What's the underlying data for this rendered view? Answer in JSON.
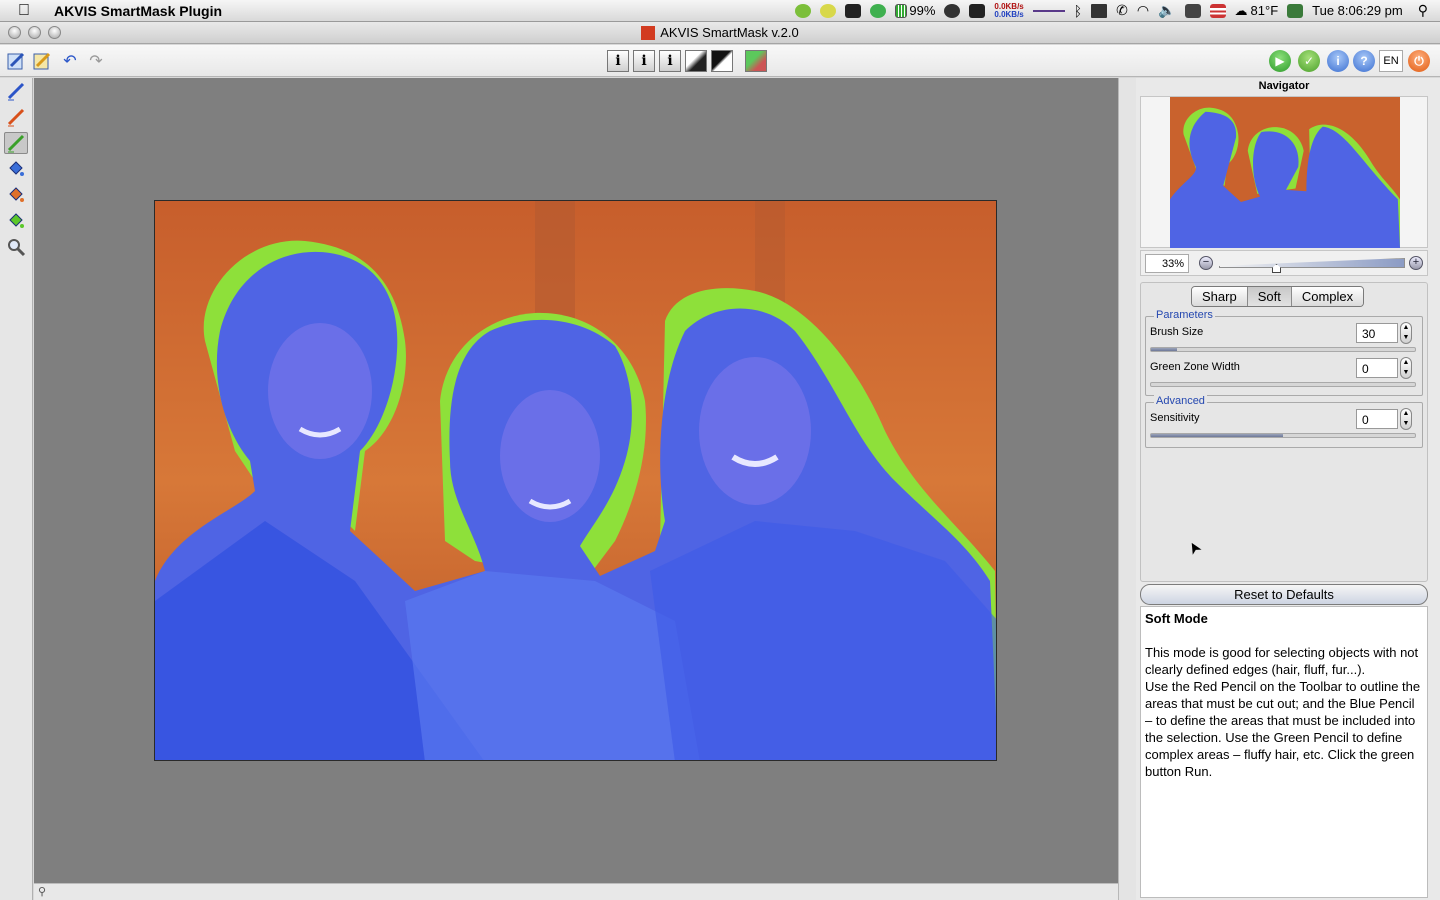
{
  "menubar": {
    "app_name": "AKVIS SmartMask Plugin",
    "battery": "99%",
    "net_up": "0.0KB/s",
    "net_down": "0.0KB/s",
    "temperature": "81°F",
    "clock": "Tue 8:06:29 pm"
  },
  "window": {
    "title": "AKVIS SmartMask v.2.0"
  },
  "toolbar": {
    "mode_buttons": [
      "i",
      "i",
      "i"
    ],
    "language": "EN"
  },
  "navigator": {
    "title": "Navigator",
    "zoom": "33%"
  },
  "modes": {
    "items": [
      "Sharp",
      "Soft",
      "Complex"
    ],
    "selected": "Soft"
  },
  "parameters": {
    "label": "Parameters",
    "brush_size_label": "Brush Size",
    "brush_size_value": "30",
    "brush_size_fraction": 0.1,
    "green_zone_label": "Green Zone Width",
    "green_zone_value": "0",
    "green_zone_fraction": 0.0
  },
  "advanced": {
    "label": "Advanced",
    "sensitivity_label": "Sensitivity",
    "sensitivity_value": "0",
    "sensitivity_fraction": 0.5
  },
  "reset_label": "Reset to Defaults",
  "help": {
    "title": "Soft Mode",
    "p1": "This mode is good for selecting objects with not clearly defined edges (hair, fluff, fur...).",
    "p2": "Use the Red Pencil on the Toolbar to outline the areas that must be cut out; and the Blue Pencil – to define the areas that must be included into the selection. Use the Green Pencil to define complex areas – fluffy hair, etc. Click the green button Run."
  },
  "colors": {
    "background_mask": "#c9622d",
    "keep_mask": "#4a5ee0",
    "edge_mask": "#8ee03a"
  }
}
